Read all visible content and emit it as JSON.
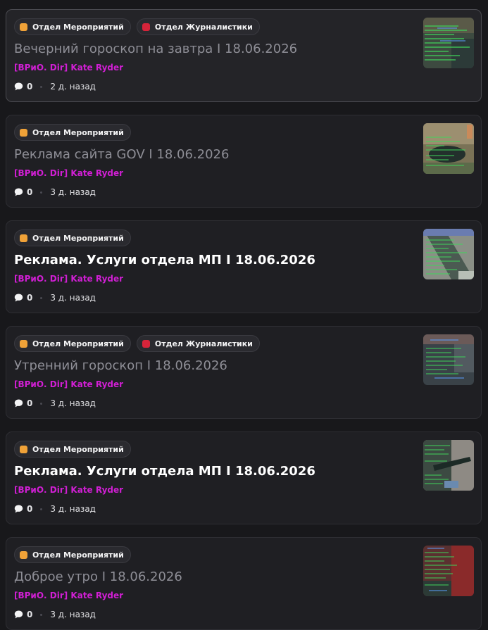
{
  "colors": {
    "background": "#18181b",
    "card": "#1f1f23",
    "author": "#d11fd4",
    "tag_events": "#f0a238",
    "tag_journalism": "#d6243a"
  },
  "icons": {
    "tag_events": "orange-square-icon",
    "tag_journalism": "red-book-icon",
    "comments": "speech-bubble-icon"
  },
  "posts": [
    {
      "tags": [
        "Отдел Мероприятий",
        "Отдел Журналистики"
      ],
      "title": "Вечерний гороскоп на завтра I 18.06.2026",
      "title_state": "read",
      "author": "[ВРиО. Dir] Kate Ryder",
      "comments": "0",
      "time": "2 д. назад"
    },
    {
      "tags": [
        "Отдел Мероприятий"
      ],
      "title": "Реклама сайта GOV I 18.06.2026",
      "title_state": "read",
      "author": "[ВРиО. Dir] Kate Ryder",
      "comments": "0",
      "time": "3 д. назад"
    },
    {
      "tags": [
        "Отдел Мероприятий"
      ],
      "title": "Реклама. Услуги отдела МП I 18.06.2026",
      "title_state": "unread",
      "author": "[ВРиО. Dir] Kate Ryder",
      "comments": "0",
      "time": "3 д. назад"
    },
    {
      "tags": [
        "Отдел Мероприятий",
        "Отдел Журналистики"
      ],
      "title": "Утренний гороскоп I 18.06.2026",
      "title_state": "read",
      "author": "[ВРиО. Dir] Kate Ryder",
      "comments": "0",
      "time": "3 д. назад"
    },
    {
      "tags": [
        "Отдел Мероприятий"
      ],
      "title": "Реклама. Услуги отдела МП I 18.06.2026",
      "title_state": "unread",
      "author": "[ВРиО. Dir] Kate Ryder",
      "comments": "0",
      "time": "3 д. назад"
    },
    {
      "tags": [
        "Отдел Мероприятий"
      ],
      "title": "Доброе утро I 18.06.2026",
      "title_state": "read",
      "author": "[ВРиО. Dir] Kate Ryder",
      "comments": "0",
      "time": "3 д. назад"
    }
  ]
}
